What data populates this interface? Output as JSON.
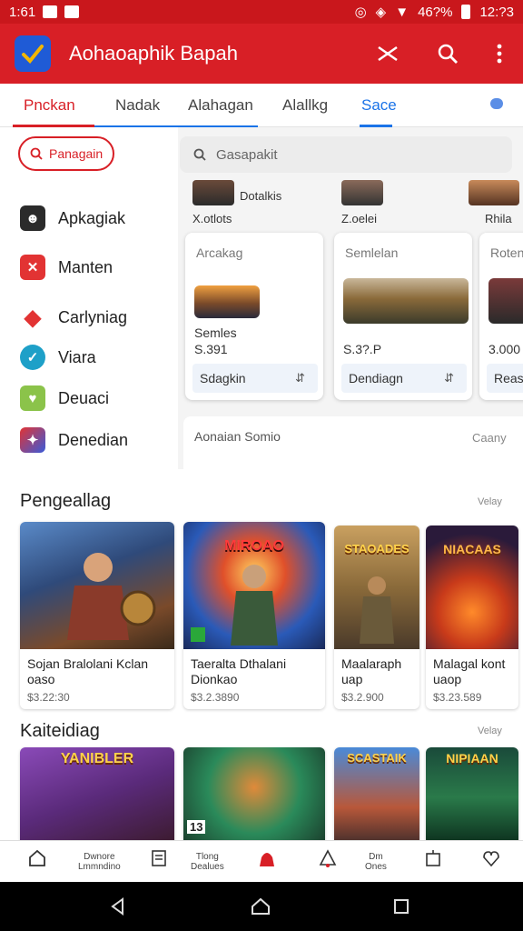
{
  "status_bar": {
    "time": "1:61",
    "battery": "46?%",
    "clock_right": "12:?3"
  },
  "app_bar": {
    "title": "Aohaoaphik Bapah"
  },
  "tabs": [
    {
      "label": "Pnckan",
      "active": true
    },
    {
      "label": "Nadak",
      "active": false
    },
    {
      "label": "Alahagan",
      "active": false
    },
    {
      "label": "Alallkg",
      "active": false
    },
    {
      "label": "Sace",
      "active": false
    }
  ],
  "filter": {
    "label": "Panagain"
  },
  "search": {
    "placeholder": "Gasapakit"
  },
  "sidebar": {
    "items": [
      {
        "label": "Apkagiak",
        "icon": "dog-icon",
        "color": "#2b2b2b"
      },
      {
        "label": "Manten",
        "icon": "x-icon",
        "color": "#e23333"
      },
      {
        "label": "Carlyniag",
        "icon": "tag-icon",
        "color": "#e23333"
      },
      {
        "label": "Viara",
        "icon": "check-circle-icon",
        "color": "#1ea0c8"
      },
      {
        "label": "Deuaci",
        "icon": "heart-icon",
        "color": "#8bc34a"
      },
      {
        "label": "Denedian",
        "icon": "game-icon",
        "color": "#d9383b"
      }
    ]
  },
  "top_row": [
    {
      "label": "Dotalkis",
      "sub": "X.otlots"
    },
    {
      "label": "",
      "sub": "Z.oelei"
    },
    {
      "label": "",
      "sub": "Rhila"
    }
  ],
  "offers": [
    {
      "head": "Arcakag",
      "name": "Semles",
      "price": "S.391",
      "button": "Sdagkin"
    },
    {
      "head": "Semlelan",
      "name": "",
      "price": "S.3?.P",
      "button": "Dendiagn"
    },
    {
      "head": "Roten",
      "name": "",
      "price": "3.000",
      "button": "Reas"
    }
  ],
  "strip": {
    "left": "Aonaian Somio",
    "right": "Caany"
  },
  "section1": {
    "title": "Pengeallag",
    "more": "Velay",
    "games": [
      {
        "name_line1": "Sojan Bralolani Kclan",
        "name_line2": "oaso",
        "price": "$3.22:30",
        "art_title": ""
      },
      {
        "name_line1": "Taeralta Dthalani",
        "name_line2": "Dionkao",
        "price": "$3.2.3890",
        "art_title": "MIROAO"
      },
      {
        "name_line1": "Maalaraph",
        "name_line2": "uap",
        "price": "$3.2.900",
        "art_title": "STAOADES"
      },
      {
        "name_line1": "Malagal kont",
        "name_line2": "uaop",
        "price": "$3.23.589",
        "art_title": "NIACAAS"
      }
    ]
  },
  "section2": {
    "title": "Kaiteidiag",
    "more": "Velay",
    "games": [
      {
        "art_title": "YANIBLER"
      },
      {
        "art_title": ""
      },
      {
        "art_title": "SCASTAIK"
      },
      {
        "art_title": "NIPIAAN"
      }
    ]
  },
  "bottom_bar": [
    {
      "label1": "",
      "label2": "",
      "icon": "home-icon"
    },
    {
      "label1": "Dwnore",
      "label2": "Lmmndino",
      "icon": ""
    },
    {
      "label1": "",
      "label2": "",
      "icon": "receipt-icon"
    },
    {
      "label1": "Tlong",
      "label2": "Dealues",
      "icon": ""
    },
    {
      "label1": "",
      "label2": "",
      "icon": "bell-icon"
    },
    {
      "label1": "",
      "label2": "",
      "icon": "alert-icon"
    },
    {
      "label1": "Dm",
      "label2": "Ones",
      "icon": ""
    },
    {
      "label1": "",
      "label2": "",
      "icon": "box-icon"
    },
    {
      "label1": "",
      "label2": "",
      "icon": "heart-broken-icon"
    }
  ],
  "colors": {
    "brand": "#d81f26",
    "accent_blue": "#1a73e8"
  }
}
